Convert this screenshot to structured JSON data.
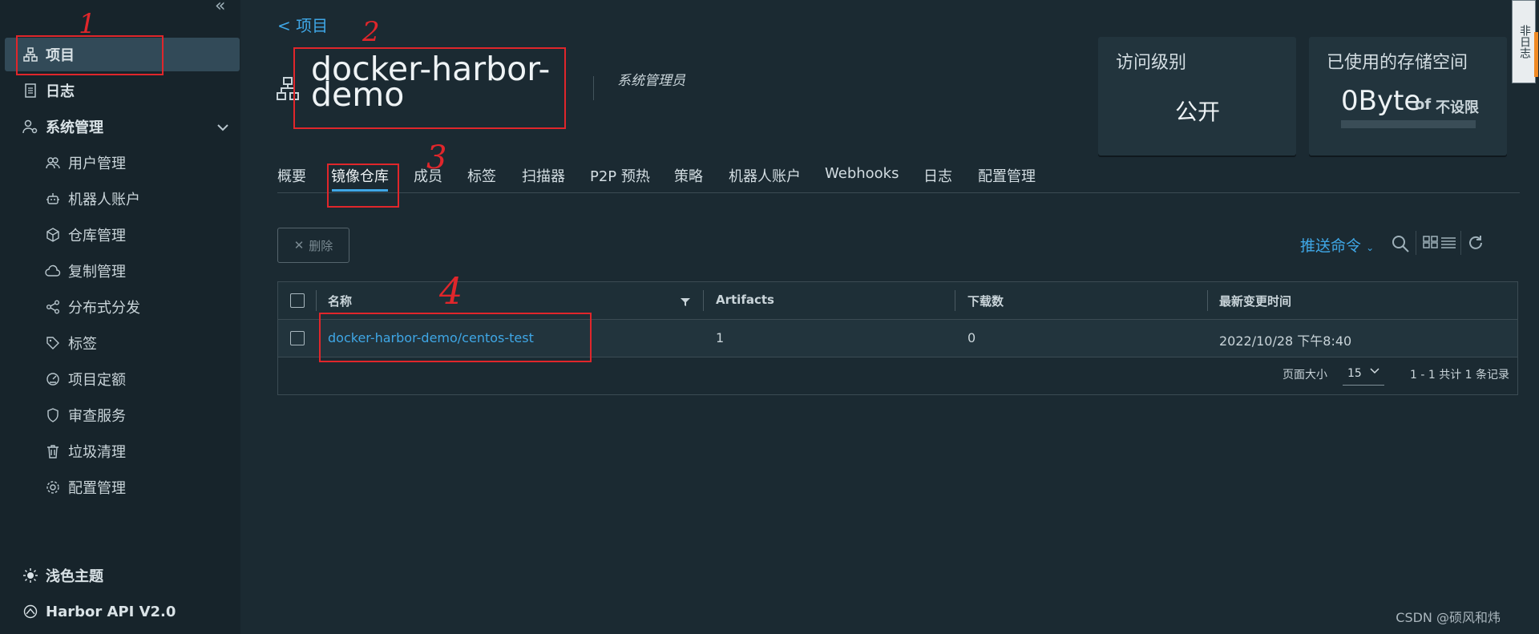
{
  "sidebar": {
    "items": [
      {
        "label": "项目",
        "icon": "project-icon"
      },
      {
        "label": "日志",
        "icon": "log-icon"
      },
      {
        "label": "系统管理",
        "icon": "admin-icon"
      },
      {
        "label": "用户管理",
        "icon": "users-icon"
      },
      {
        "label": "机器人账户",
        "icon": "robot-icon"
      },
      {
        "label": "仓库管理",
        "icon": "box-icon"
      },
      {
        "label": "复制管理",
        "icon": "cloud-icon"
      },
      {
        "label": "分布式分发",
        "icon": "share-icon"
      },
      {
        "label": "标签",
        "icon": "tag-icon"
      },
      {
        "label": "项目定额",
        "icon": "gauge-icon"
      },
      {
        "label": "审查服务",
        "icon": "shield-icon"
      },
      {
        "label": "垃圾清理",
        "icon": "trash-icon"
      },
      {
        "label": "配置管理",
        "icon": "gear-icon"
      }
    ],
    "theme": "浅色主题",
    "api": "Harbor API V2.0"
  },
  "header": {
    "back": "< 项目",
    "title": "docker-harbor-demo",
    "role": "系统管理员"
  },
  "cards": {
    "access": {
      "title": "访问级别",
      "value": "公开"
    },
    "storage": {
      "title": "已使用的存储空间",
      "value": "0Byte",
      "of": "of",
      "limit": "不设限"
    }
  },
  "tabs": [
    "概要",
    "镜像仓库",
    "成员",
    "标签",
    "扫描器",
    "P2P 预热",
    "策略",
    "机器人账户",
    "Webhooks",
    "日志",
    "配置管理"
  ],
  "toolbar": {
    "delete": "删除",
    "push": "推送命令"
  },
  "table": {
    "headers": [
      "名称",
      "Artifacts",
      "下载数",
      "最新变更时间"
    ],
    "rows": [
      {
        "name": "docker-harbor-demo/centos-test",
        "artifacts": "1",
        "downloads": "0",
        "updated": "2022/10/28 下午8:40"
      }
    ],
    "page_size_label": "页面大小",
    "page_size": "15",
    "summary": "1 - 1 共计 1 条记录"
  },
  "annotations": [
    "1",
    "2",
    "3",
    "4"
  ],
  "watermark": "CSDN @硕风和炜",
  "side_tab": "非日志"
}
